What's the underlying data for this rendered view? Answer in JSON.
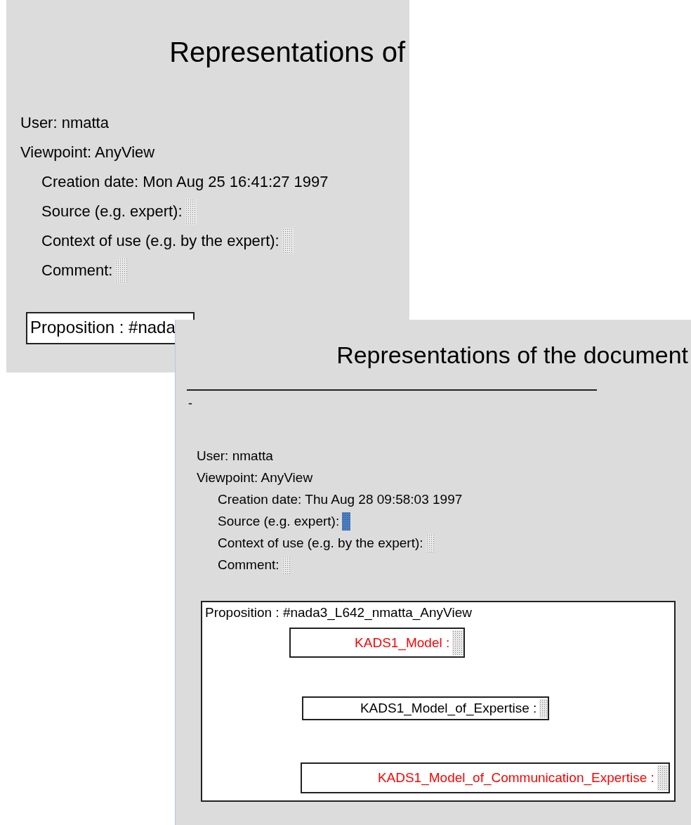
{
  "windows": [
    {
      "title": "Representations of",
      "user": "User: nmatta",
      "viewpoint": "Viewpoint: AnyView",
      "fields": [
        {
          "kind": "text",
          "label": "Creation date: Mon Aug 25 16:41:27 1997"
        },
        {
          "kind": "slot",
          "label": "Source (e.g. expert):",
          "selected": false
        },
        {
          "kind": "slot",
          "label": "Context of use (e.g. by the expert):",
          "selected": false
        },
        {
          "kind": "slot",
          "label": "Comment:",
          "selected": false
        }
      ],
      "proposition": "Proposition : #nada"
    },
    {
      "title": "Representations of the document",
      "user": "User: nmatta",
      "viewpoint": "Viewpoint: AnyView",
      "rule": true,
      "dash": "-",
      "fields": [
        {
          "kind": "text",
          "label": "Creation date: Thu Aug 28 09:58:03 1997"
        },
        {
          "kind": "slot",
          "label": "Source (e.g. expert):",
          "selected": true
        },
        {
          "kind": "slot",
          "label": "Context of use (e.g. by the expert):",
          "selected": false
        },
        {
          "kind": "slot",
          "label": "Comment:",
          "selected": false
        }
      ],
      "proposition": "Proposition : #nada3_L642_nmatta_AnyView",
      "models": [
        {
          "label": "KADS1_Model :",
          "color": "#ff0000"
        },
        {
          "label": "KADS1_Model_of_Expertise :",
          "color": "#000000"
        },
        {
          "label": "KADS1_Model_of_Communication_Expertise :",
          "color": "#ff0000"
        }
      ]
    }
  ]
}
